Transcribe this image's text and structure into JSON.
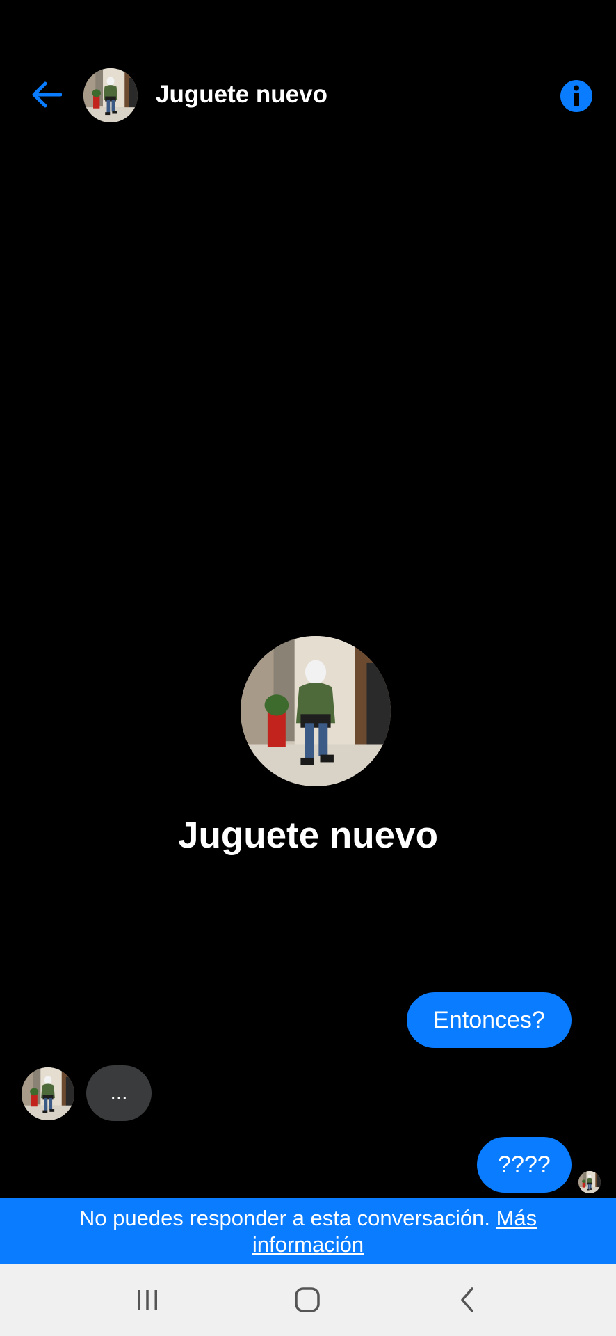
{
  "header": {
    "title": "Juguete nuevo",
    "back_icon": "arrow-left-icon",
    "info_icon": "info-icon",
    "accent_color": "#0a7cff"
  },
  "profile": {
    "name": "Juguete nuevo"
  },
  "messages": [
    {
      "direction": "outgoing",
      "text": "Entonces?"
    },
    {
      "direction": "incoming",
      "text": "..."
    },
    {
      "direction": "outgoing",
      "text": "????"
    }
  ],
  "notice": {
    "text": "No puedes responder a esta conversación. ",
    "link": "Más información",
    "background": "#0a7cff"
  },
  "system_nav": {
    "recents_icon": "recents-icon",
    "home_icon": "home-icon",
    "back_icon": "back-chevron-icon"
  },
  "colors": {
    "background": "#000000",
    "outgoing_bubble": "#0a7cff",
    "incoming_bubble": "#3a3b3c",
    "nav_bar": "#f0f0f0"
  }
}
